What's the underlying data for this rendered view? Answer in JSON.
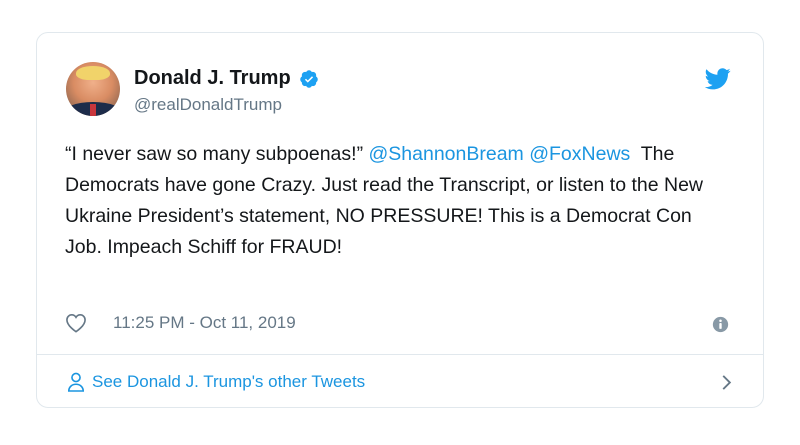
{
  "author": {
    "name": "Donald J. Trump",
    "handle": "@realDonaldTrump",
    "verified": true,
    "avatar_icon": "profile-photo"
  },
  "tweet": {
    "quote": "“I never saw so many subpoenas!”",
    "mention1": "@ShannonBream",
    "mention2": "@FoxNews",
    "body": "  The Democrats have gone Crazy. Just read the Transcript, or listen to the New Ukraine President’s statement, NO PRESSURE! This is a Democrat Con Job. Impeach Schiff for FRAUD!",
    "timestamp": "11:25 PM - Oct 11, 2019"
  },
  "footer": {
    "link_label": "See Donald J. Trump's other Tweets"
  },
  "colors": {
    "accent": "#1b95e0",
    "text": "#14171a",
    "muted": "#657786",
    "border": "#e1e8ed"
  },
  "icons": [
    "twitter-bird-icon",
    "verified-badge-icon",
    "heart-icon",
    "info-icon",
    "person-icon",
    "chevron-right-icon"
  ]
}
